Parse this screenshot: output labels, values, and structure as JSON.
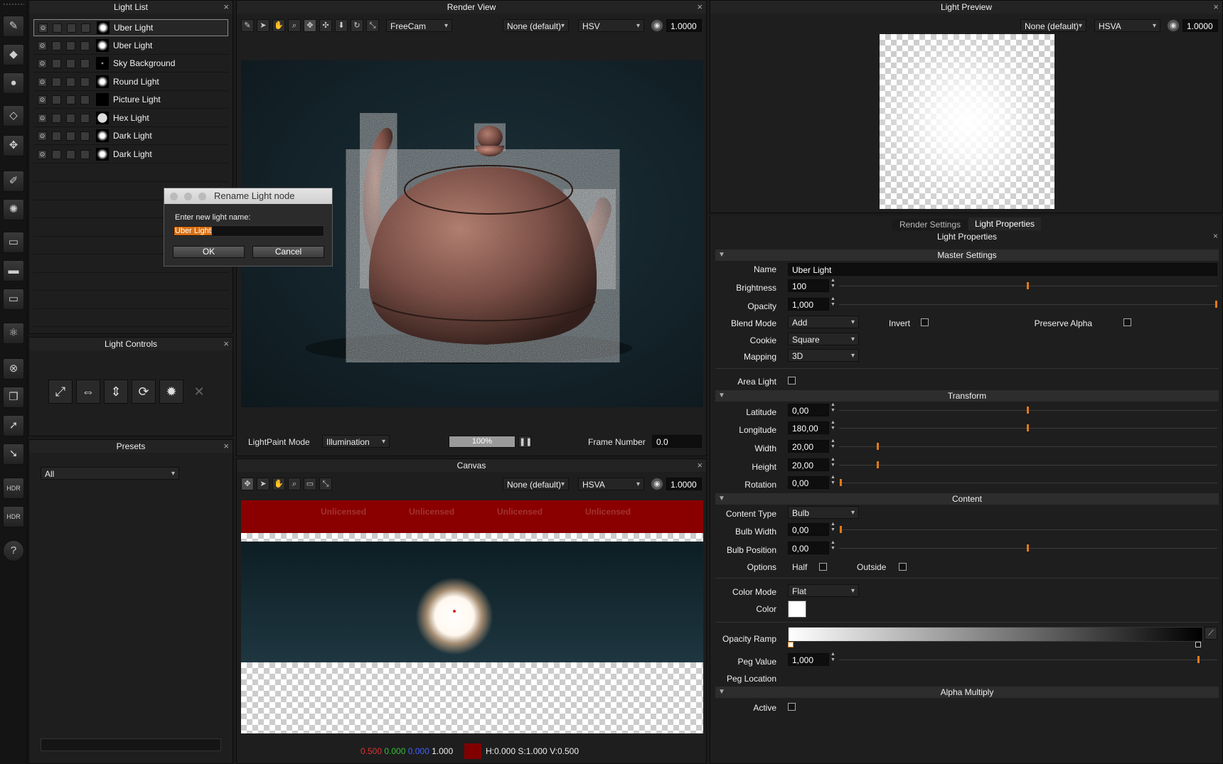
{
  "light_list": {
    "title": "Light List",
    "close": "×",
    "items": [
      {
        "name": "Uber Light",
        "selected": true
      },
      {
        "name": "Uber Light"
      },
      {
        "name": "Sky Background"
      },
      {
        "name": "Round Light"
      },
      {
        "name": "Picture Light"
      },
      {
        "name": "Hex Light"
      },
      {
        "name": "Dark Light"
      },
      {
        "name": "Dark Light"
      }
    ]
  },
  "rename_dialog": {
    "title": "Rename Light node",
    "prompt": "Enter new light name:",
    "value": "Uber Light",
    "ok": "OK",
    "cancel": "Cancel"
  },
  "light_controls": {
    "title": "Light Controls",
    "close": "×"
  },
  "presets": {
    "title": "Presets",
    "close": "×",
    "filter": "All"
  },
  "render_view": {
    "title": "Render View",
    "close": "×",
    "camera": "FreeCam",
    "lut": "None (default)",
    "colorspace": "HSV",
    "exposure": "1.0000",
    "paint_mode_label": "LightPaint Mode",
    "paint_mode": "Illumination",
    "progress": "100%",
    "progress_value": 1.0,
    "frame_label": "Frame Number",
    "frame": "0.0"
  },
  "canvas": {
    "title": "Canvas",
    "close": "×",
    "lut": "None (default)",
    "colorspace": "HSVA",
    "exposure": "1.0000",
    "watermarks": [
      "Unlicensed",
      "Unlicensed",
      "Unlicensed",
      "Unlicensed"
    ],
    "readout": {
      "r": "0.500",
      "g": "0.000",
      "b": "0.000",
      "a": "1.000",
      "hsv": "H:0.000 S:1.000 V:0.500"
    }
  },
  "light_preview": {
    "title": "Light Preview",
    "close": "×",
    "lut": "None (default)",
    "colorspace": "HSVA",
    "exposure": "1.0000"
  },
  "properties": {
    "tabs": [
      "Render Settings",
      "Light Properties"
    ],
    "title": "Light Properties",
    "close": "×",
    "sections": {
      "master": "Master Settings",
      "transform": "Transform",
      "content": "Content",
      "alpha": "Alpha Multiply"
    },
    "labels": {
      "name": "Name",
      "brightness": "Brightness",
      "opacity": "Opacity",
      "blend_mode": "Blend Mode",
      "invert": "Invert",
      "preserve_alpha": "Preserve Alpha",
      "cookie": "Cookie",
      "mapping": "Mapping",
      "area_light": "Area Light",
      "latitude": "Latitude",
      "longitude": "Longitude",
      "width": "Width",
      "height": "Height",
      "rotation": "Rotation",
      "content_type": "Content Type",
      "bulb_width": "Bulb Width",
      "bulb_position": "Bulb Position",
      "options": "Options",
      "half": "Half",
      "outside": "Outside",
      "color_mode": "Color Mode",
      "color": "Color",
      "opacity_ramp": "Opacity Ramp",
      "peg_value": "Peg Value",
      "peg_location": "Peg Location",
      "active": "Active"
    },
    "values": {
      "name": "Uber Light",
      "brightness": "100",
      "opacity": "1,000",
      "blend_mode": "Add",
      "cookie": "Square",
      "mapping": "3D",
      "latitude": "0,00",
      "longitude": "180,00",
      "width": "20,00",
      "height": "20,00",
      "rotation": "0,00",
      "content_type": "Bulb",
      "bulb_width": "0,00",
      "bulb_position": "0,00",
      "color_mode": "Flat",
      "peg_value": "1,000"
    },
    "color_swatch": "#ffffff",
    "accent": "#e07a1a"
  },
  "toolbar_icons": [
    "add-light-icon",
    "paint-icon",
    "light-bulb-icon",
    "eraser-icon",
    "pattern-icon",
    "brush-icon",
    "sun-icon",
    "gradient-icon",
    "gradient2-icon",
    "gradient3-icon",
    "atom-icon",
    "close-circle-icon",
    "layers-icon",
    "arrow-icon",
    "arrow-down-icon",
    "hdr-icon",
    "hdr-refresh-icon",
    "help-icon"
  ],
  "toolbar_labels": {
    "hdr": "HDR",
    "hdr2": "HDR",
    "help": "?"
  }
}
